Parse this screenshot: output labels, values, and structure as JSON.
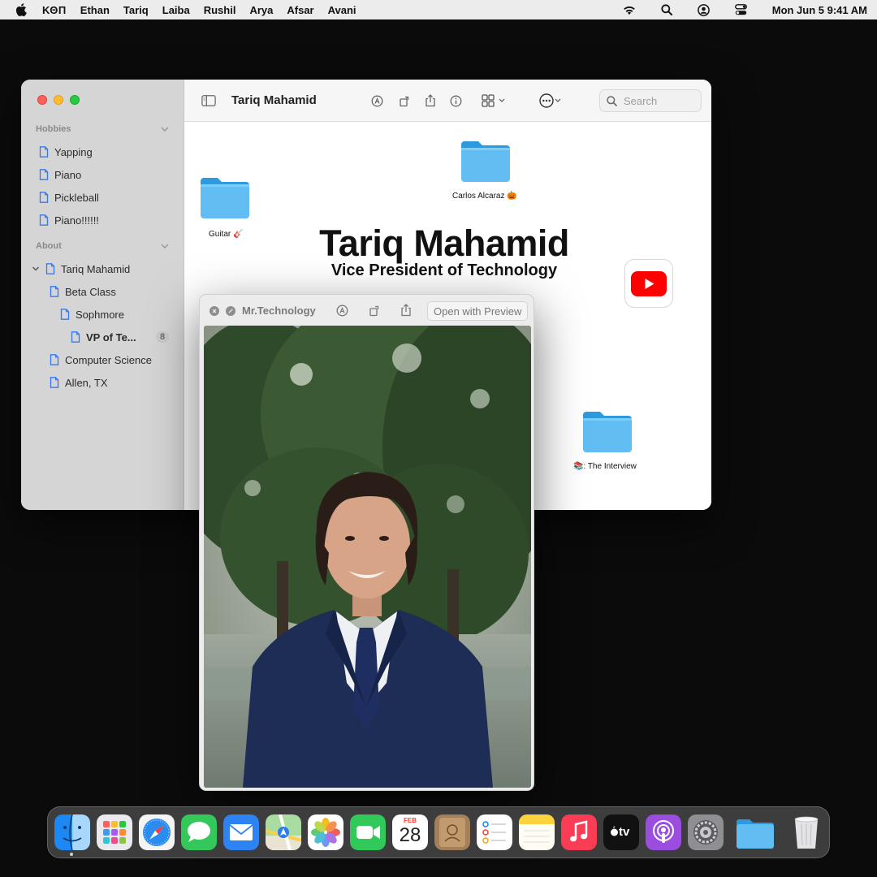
{
  "menubar": {
    "app_name": "ΚΘΠ",
    "menus": [
      "Ethan",
      "Tariq",
      "Laiba",
      "Rushil",
      "Arya",
      "Afsar",
      "Avani"
    ],
    "clock": "Mon Jun 5  9:41 AM",
    "status_icons": [
      "wifi-icon",
      "search-icon",
      "user-icon",
      "control-center-icon"
    ]
  },
  "finder": {
    "title": "Tariq Mahamid",
    "search_placeholder": "Search",
    "sidebar": {
      "sections": [
        {
          "label": "Hobbies",
          "items": [
            "Yapping",
            "Piano",
            "Pickleball",
            "Piano!!!!!!"
          ]
        },
        {
          "label": "About",
          "items": [
            "Tariq Mahamid",
            "Beta Class",
            "Sophmore",
            "VP of Te...",
            "Computer Science",
            "Allen, TX"
          ]
        }
      ],
      "badge": "8"
    },
    "content": {
      "heading": "Tariq Mahamid",
      "subheading": "Vice President of Technology",
      "folders": [
        {
          "label": "Carlos Alcaraz 🎃"
        },
        {
          "label": "Guitar 🎸"
        },
        {
          "label": "📚: The Interview"
        }
      ]
    }
  },
  "quicklook": {
    "title": "Mr.Technology",
    "open_with": "Open with Preview"
  },
  "dock": {
    "apps": [
      "finder",
      "launchpad",
      "safari",
      "messages",
      "mail",
      "maps",
      "photos",
      "facetime",
      "calendar",
      "contacts",
      "reminders",
      "notes",
      "music",
      "tv",
      "podcasts",
      "system-settings",
      "folder",
      "trash"
    ],
    "calendar_month": "FEB",
    "calendar_day": "28",
    "tv_label": "tv"
  },
  "colors": {
    "accent": "#3478f6",
    "folder_blue": "#5fb8f0",
    "youtube_red": "#ff0000"
  }
}
